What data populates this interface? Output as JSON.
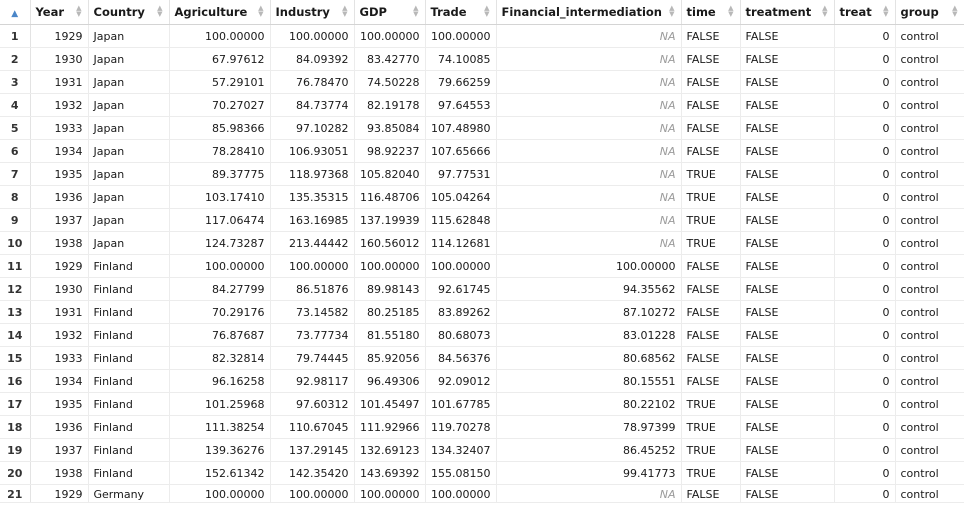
{
  "columns": [
    "Year",
    "Country",
    "Agriculture",
    "Industry",
    "GDP",
    "Trade",
    "Financial_intermediation",
    "time",
    "treatment",
    "treat",
    "group"
  ],
  "sort_up_glyph": "▲",
  "rows": [
    [
      "1",
      "1929",
      "Japan",
      "100.00000",
      "100.00000",
      "100.00000",
      "100.00000",
      "NA",
      "FALSE",
      "FALSE",
      "0",
      "control"
    ],
    [
      "2",
      "1930",
      "Japan",
      "67.97612",
      "84.09392",
      "83.42770",
      "74.10085",
      "NA",
      "FALSE",
      "FALSE",
      "0",
      "control"
    ],
    [
      "3",
      "1931",
      "Japan",
      "57.29101",
      "76.78470",
      "74.50228",
      "79.66259",
      "NA",
      "FALSE",
      "FALSE",
      "0",
      "control"
    ],
    [
      "4",
      "1932",
      "Japan",
      "70.27027",
      "84.73774",
      "82.19178",
      "97.64553",
      "NA",
      "FALSE",
      "FALSE",
      "0",
      "control"
    ],
    [
      "5",
      "1933",
      "Japan",
      "85.98366",
      "97.10282",
      "93.85084",
      "107.48980",
      "NA",
      "FALSE",
      "FALSE",
      "0",
      "control"
    ],
    [
      "6",
      "1934",
      "Japan",
      "78.28410",
      "106.93051",
      "98.92237",
      "107.65666",
      "NA",
      "FALSE",
      "FALSE",
      "0",
      "control"
    ],
    [
      "7",
      "1935",
      "Japan",
      "89.37775",
      "118.97368",
      "105.82040",
      "97.77531",
      "NA",
      "TRUE",
      "FALSE",
      "0",
      "control"
    ],
    [
      "8",
      "1936",
      "Japan",
      "103.17410",
      "135.35315",
      "116.48706",
      "105.04264",
      "NA",
      "TRUE",
      "FALSE",
      "0",
      "control"
    ],
    [
      "9",
      "1937",
      "Japan",
      "117.06474",
      "163.16985",
      "137.19939",
      "115.62848",
      "NA",
      "TRUE",
      "FALSE",
      "0",
      "control"
    ],
    [
      "10",
      "1938",
      "Japan",
      "124.73287",
      "213.44442",
      "160.56012",
      "114.12681",
      "NA",
      "TRUE",
      "FALSE",
      "0",
      "control"
    ],
    [
      "11",
      "1929",
      "Finland",
      "100.00000",
      "100.00000",
      "100.00000",
      "100.00000",
      "100.00000",
      "FALSE",
      "FALSE",
      "0",
      "control"
    ],
    [
      "12",
      "1930",
      "Finland",
      "84.27799",
      "86.51876",
      "89.98143",
      "92.61745",
      "94.35562",
      "FALSE",
      "FALSE",
      "0",
      "control"
    ],
    [
      "13",
      "1931",
      "Finland",
      "70.29176",
      "73.14582",
      "80.25185",
      "83.89262",
      "87.10272",
      "FALSE",
      "FALSE",
      "0",
      "control"
    ],
    [
      "14",
      "1932",
      "Finland",
      "76.87687",
      "73.77734",
      "81.55180",
      "80.68073",
      "83.01228",
      "FALSE",
      "FALSE",
      "0",
      "control"
    ],
    [
      "15",
      "1933",
      "Finland",
      "82.32814",
      "79.74445",
      "85.92056",
      "84.56376",
      "80.68562",
      "FALSE",
      "FALSE",
      "0",
      "control"
    ],
    [
      "16",
      "1934",
      "Finland",
      "96.16258",
      "92.98117",
      "96.49306",
      "92.09012",
      "80.15551",
      "FALSE",
      "FALSE",
      "0",
      "control"
    ],
    [
      "17",
      "1935",
      "Finland",
      "101.25968",
      "97.60312",
      "101.45497",
      "101.67785",
      "80.22102",
      "TRUE",
      "FALSE",
      "0",
      "control"
    ],
    [
      "18",
      "1936",
      "Finland",
      "111.38254",
      "110.67045",
      "111.92966",
      "119.70278",
      "78.97399",
      "TRUE",
      "FALSE",
      "0",
      "control"
    ],
    [
      "19",
      "1937",
      "Finland",
      "139.36276",
      "137.29145",
      "132.69123",
      "134.32407",
      "86.45252",
      "TRUE",
      "FALSE",
      "0",
      "control"
    ],
    [
      "20",
      "1938",
      "Finland",
      "152.61342",
      "142.35420",
      "143.69392",
      "155.08150",
      "99.41773",
      "TRUE",
      "FALSE",
      "0",
      "control"
    ],
    [
      "21",
      "1929",
      "Germany",
      "100.00000",
      "100.00000",
      "100.00000",
      "100.00000",
      "NA",
      "FALSE",
      "FALSE",
      "0",
      "control"
    ]
  ]
}
